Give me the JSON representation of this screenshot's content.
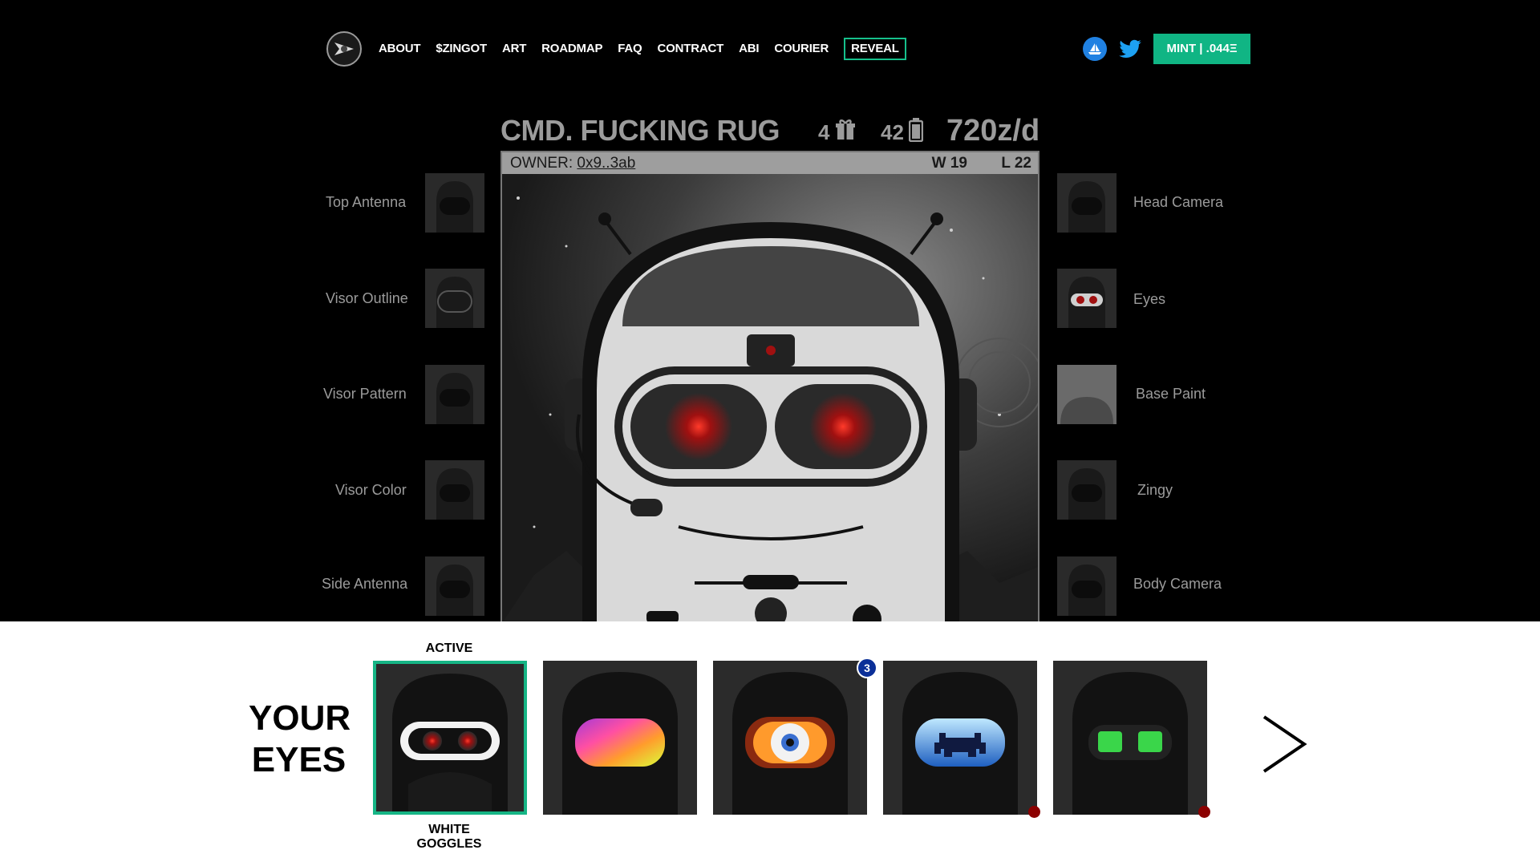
{
  "nav": {
    "items": [
      "ABOUT",
      "$ZINGOT",
      "ART",
      "ROADMAP",
      "FAQ",
      "CONTRACT",
      "ABI",
      "COURIER"
    ],
    "reveal": "REVEAL",
    "mint": "MINT | .044Ξ"
  },
  "icons": {
    "logo": "logo-icon",
    "opensea": "opensea-icon",
    "twitter": "twitter-icon",
    "gift": "gift-icon",
    "battery": "battery-icon",
    "chevron": "chevron-right-icon"
  },
  "bot": {
    "name": "CMD. FUCKING RUG",
    "gifts": "4",
    "battery": "42",
    "rate": "720z/d",
    "owner_label": "OWNER:",
    "owner_addr": "0x9..3ab",
    "wins": "W 19",
    "losses": "L 22"
  },
  "traits_left": [
    "Top Antenna",
    "Visor Outline",
    "Visor Pattern",
    "Visor Color",
    "Side Antenna"
  ],
  "traits_right": [
    "Head Camera",
    "Eyes",
    "Base Paint",
    "Zingy",
    "Body Camera"
  ],
  "eyes_panel": {
    "title_1": "YOUR",
    "title_2": "EYES",
    "active_label": "ACTIVE",
    "active_name": "WHITE GOGGLES",
    "badge_count": "3"
  },
  "colors": {
    "accent": "#10b584",
    "badge": "#0b2f98",
    "dot": "#8c0000"
  }
}
